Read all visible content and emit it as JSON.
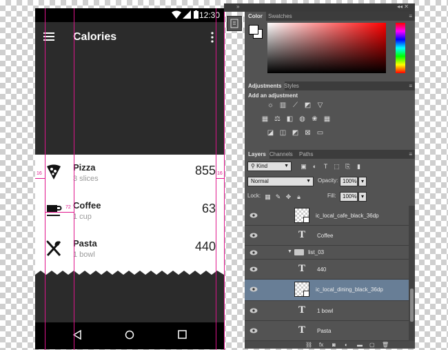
{
  "status_bar": {
    "time": "12:30"
  },
  "app_bar": {
    "title": "Calories"
  },
  "items": [
    {
      "name": "Pizza",
      "portion": "3 slices",
      "calories": "855",
      "icon": "pizza-icon"
    },
    {
      "name": "Coffee",
      "portion": "1 cup",
      "calories": "63",
      "icon": "coffee-cup-icon"
    },
    {
      "name": "Pasta",
      "portion": "1 bowl",
      "calories": "440",
      "icon": "dining-icon"
    }
  ],
  "guides": {
    "left_margin": "16",
    "right_margin": "16",
    "keyline": "72"
  },
  "colors": {
    "guide": "#e0148c",
    "dark_surface": "#2b2b2b",
    "panel": "#535353",
    "selected_layer": "#687e96"
  },
  "photoshop": {
    "topbar": {
      "collapse": "»",
      "controls": "◂◂ ✕"
    },
    "color_tabs": [
      "Color",
      "Swatches"
    ],
    "adjustment_tabs": [
      "Adjustments",
      "Styles"
    ],
    "adjustments_heading": "Add an adjustment",
    "layer_tabs": [
      "Layers",
      "Channels",
      "Paths"
    ],
    "filter_kind": "Kind",
    "blend_mode": "Normal",
    "opacity_label": "Opacity:",
    "opacity_value": "100%",
    "lock_label": "Lock:",
    "fill_label": "Fill:",
    "fill_value": "100%",
    "layers": [
      {
        "name": "ic_local_cafe_black_36dp",
        "kind": "smart"
      },
      {
        "name": "Coffee",
        "kind": "text"
      },
      {
        "name": "list_03",
        "kind": "group"
      },
      {
        "name": "440",
        "kind": "text"
      },
      {
        "name": "ic_local_dining_black_36dp",
        "kind": "smart",
        "selected": true
      },
      {
        "name": "1 bowl",
        "kind": "text"
      },
      {
        "name": "Pasta",
        "kind": "text"
      }
    ]
  }
}
